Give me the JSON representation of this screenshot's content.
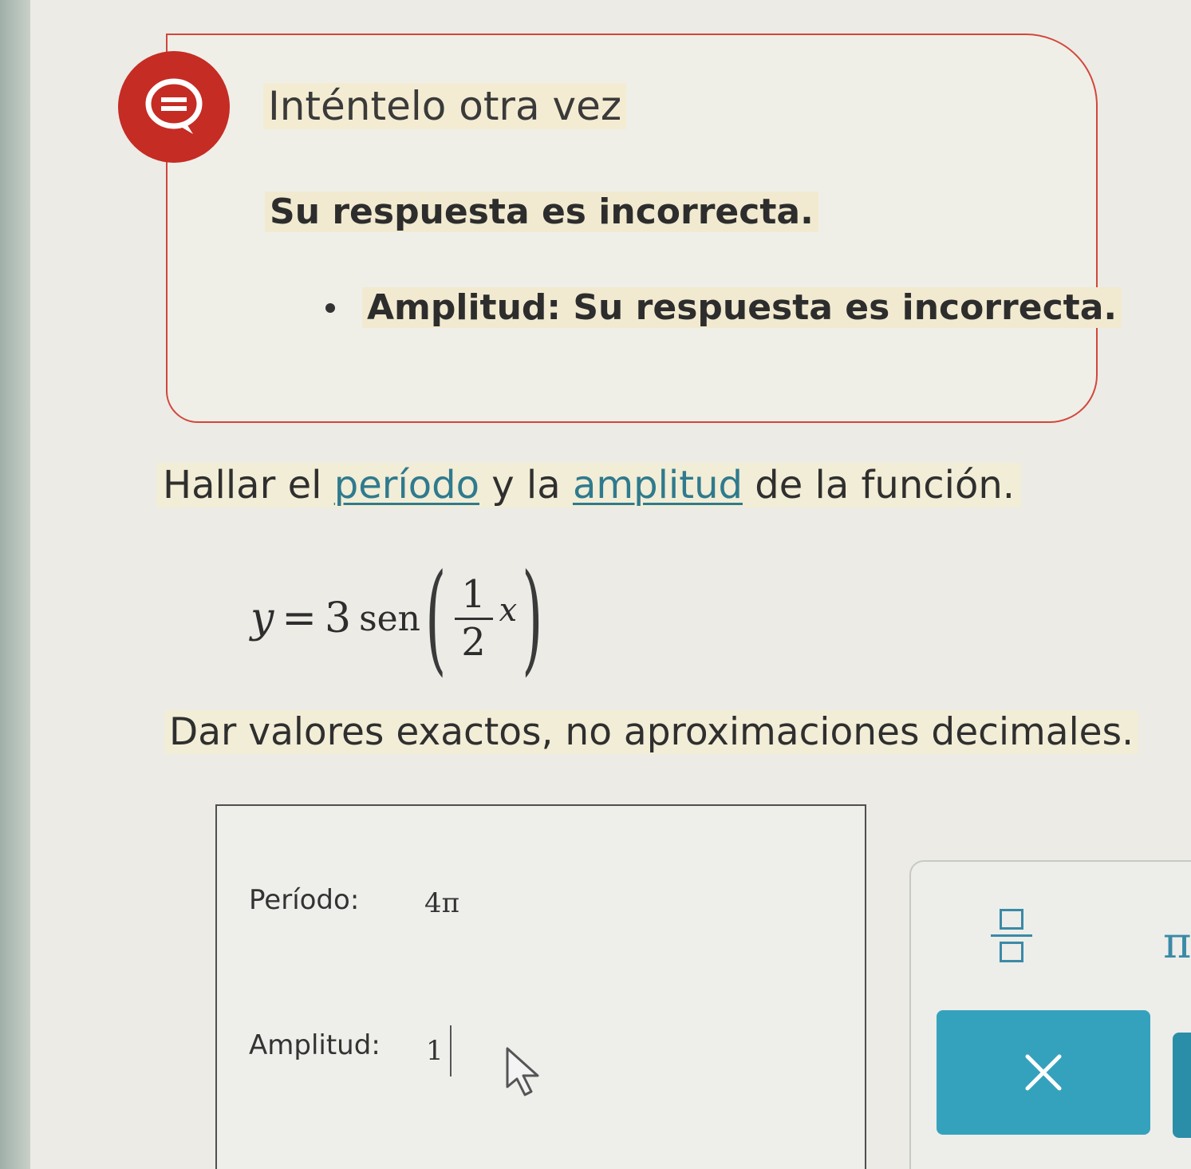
{
  "feedback": {
    "title": "Inténtelo otra vez",
    "message": "Su respuesta es incorrecta.",
    "details": [
      "Amplitud: Su respuesta es incorrecta."
    ],
    "icon": "speech-bubble-icon",
    "accent_color": "#c52c24"
  },
  "question": {
    "prefix": "Hallar el ",
    "term1": "período",
    "middle": " y la ",
    "term2": "amplitud",
    "suffix": " de la función.",
    "term_color": "#2f7a8e"
  },
  "formula": {
    "lhs": "y",
    "equals": "=",
    "coefficient": "3",
    "function": "sen",
    "open_paren": "(",
    "numerator": "1",
    "denominator": "2",
    "variable": "x",
    "close_paren": ")"
  },
  "instructions": "Dar valores exactos, no aproximaciones decimales.",
  "answers": {
    "period_label": "Período:",
    "period_value": "4π",
    "amplitude_label": "Amplitud:",
    "amplitude_value": "1"
  },
  "toolbar": {
    "fraction_icon": "fraction-template-icon",
    "pi_symbol": "π",
    "clear_icon": "close-icon",
    "button_color": "#35a2bd"
  }
}
